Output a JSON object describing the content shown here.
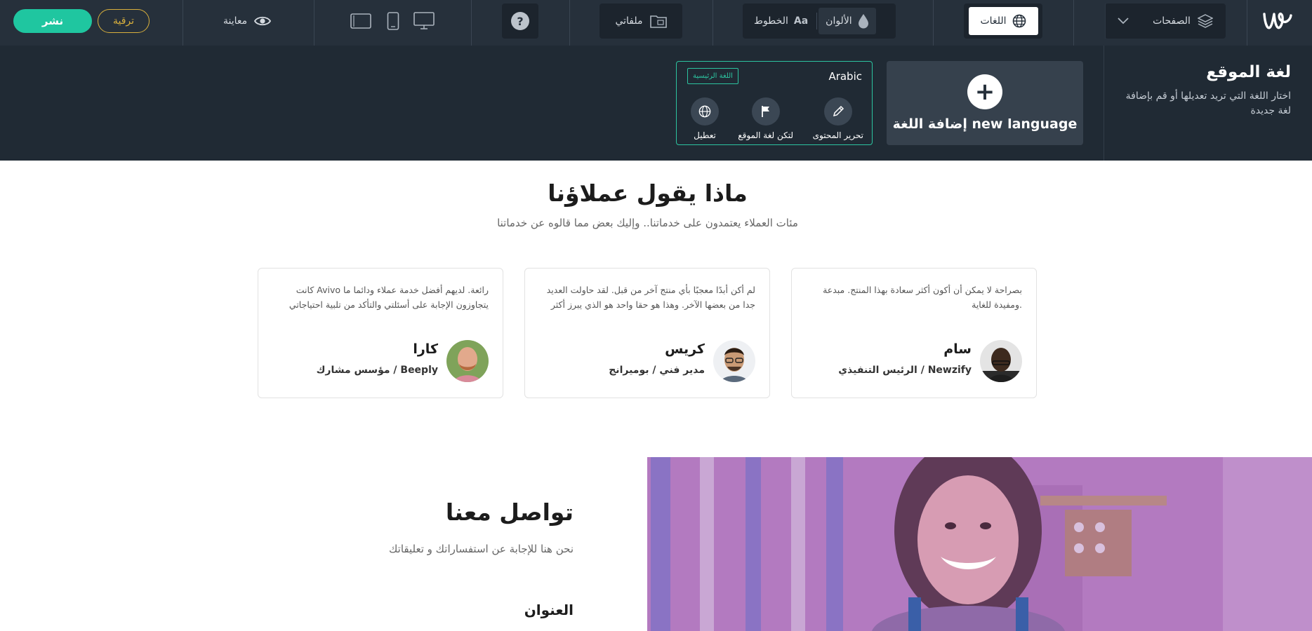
{
  "toolbar": {
    "publish_label": "نشر",
    "upgrade_label": "ترقية",
    "preview_label": "معاينة",
    "files_label": "ملفاتي",
    "colors_label": "الألوان",
    "fonts_label": "الخطوط",
    "fonts_icon_text": "Aa",
    "languages_label": "اللغات",
    "pages_label": "الصفحات",
    "help_glyph": "?"
  },
  "language_panel": {
    "title": "لغة الموقع",
    "subtitle": "اختار اللغة التي تريد تعديلها أو قم بإضافة لغة جديدة",
    "add_label": "إضافة اللغة new language",
    "add_glyph": "+",
    "language": {
      "name": "Arabic",
      "badge": "اللغة الرئيسية",
      "actions": [
        {
          "label": "تحرير المحتوى",
          "icon": "pencil-icon"
        },
        {
          "label": "لتكن لغة الموقع",
          "icon": "flag-icon"
        },
        {
          "label": "تعطيل",
          "icon": "globe-icon"
        }
      ]
    }
  },
  "testimonials": {
    "title": "ماذا يقول عملاؤنا",
    "subtitle": "مئات العملاء يعتمدون على خدماتنا.. وإليك بعض مما قالوه عن خدماتنا",
    "items": [
      {
        "quote": "بصراحة لا يمكن أن أكون أكثر سعادة بهذا المنتج. مبدعة ومفيدة للغاية.",
        "name": "سام",
        "role": "الرئيس التنفيذي / Newzify"
      },
      {
        "quote": "لم أكن أبدًا معجبًا بأي منتج آخر من قبل. لقد حاولت العديد جدا من بعضها الآخر. وهذا هو حقا واحد هو الذي يبرز أكثر",
        "name": "كريس",
        "role": "مدير فني / بوميرانج"
      },
      {
        "quote": "كانت Avivo رائعة. لديهم أفضل خدمة عملاء ودائما ما يتجاوزون الإجابة على أسئلتي والتأكد من تلبية احتياجاتي",
        "name": "كارا",
        "role": "مؤسس مشارك / Beeply"
      }
    ]
  },
  "contact": {
    "title": "تواصل معنا",
    "subtitle": "نحن هنا للإجابة عن استفساراتك و تعليقاتك",
    "address_label": "العنوان"
  },
  "colors": {
    "toolbar_bg": "#26303b",
    "panel_bg": "#202a34",
    "accent": "#1fc6a0",
    "upgrade": "#d9b03d",
    "hero_overlay": "#a35fb0"
  }
}
